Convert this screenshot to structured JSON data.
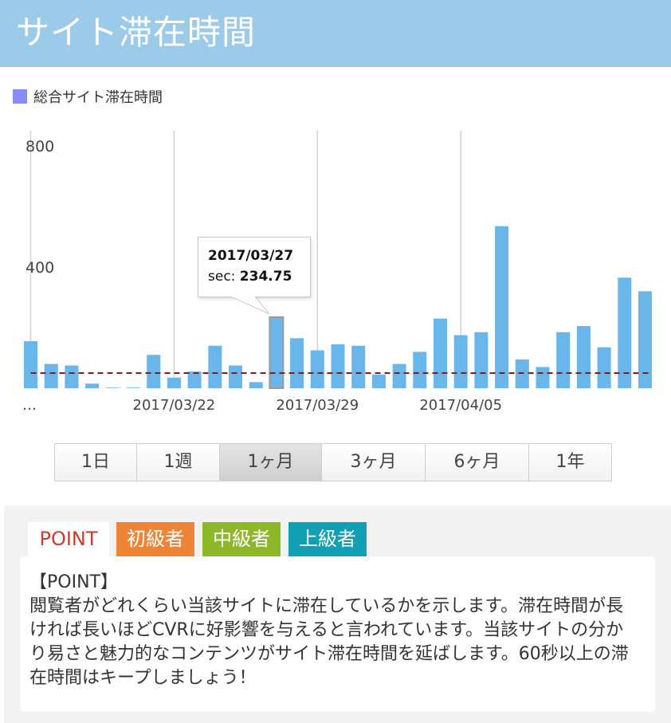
{
  "header": {
    "title": "サイト滞在時間"
  },
  "legend": {
    "label": "総合サイト滞在時間",
    "color": "#8b8bf7"
  },
  "tooltip": {
    "date": "2017/03/27",
    "label": "sec: ",
    "value": "234.75"
  },
  "chart_data": {
    "type": "bar",
    "series": [
      {
        "name": "総合サイト滞在時間",
        "color": "#68b6ea",
        "values": [
          155,
          80,
          75,
          15,
          2,
          2,
          110,
          35,
          55,
          140,
          75,
          20,
          234.75,
          165,
          125,
          145,
          140,
          45,
          80,
          120,
          230,
          175,
          185,
          535,
          95,
          70,
          185,
          205,
          135,
          365,
          320
        ]
      }
    ],
    "highlight_index": 12,
    "average_line": {
      "value": 50,
      "color": "#8b1a1a",
      "style": "dashed"
    },
    "ylim": [
      0,
      800
    ],
    "yticks": [
      {
        "value": 800,
        "label": "800"
      },
      {
        "value": 400,
        "label": "400"
      }
    ],
    "xticks": [
      {
        "index": 0,
        "label": "…"
      },
      {
        "index": 7,
        "label": "2017/03/22"
      },
      {
        "index": 14,
        "label": "2017/03/29"
      },
      {
        "index": 21,
        "label": "2017/04/05"
      }
    ],
    "grid": "vertical"
  },
  "range_selector": {
    "buttons": [
      {
        "label": "1日",
        "active": false
      },
      {
        "label": "1週",
        "active": false
      },
      {
        "label": "1ヶ月",
        "active": true
      },
      {
        "label": "3ヶ月",
        "active": false
      },
      {
        "label": "6ヶ月",
        "active": false
      },
      {
        "label": "1年",
        "active": false
      }
    ]
  },
  "tabs": {
    "point": "POINT",
    "beginner": "初級者",
    "intermediate": "中級者",
    "advanced": "上級者"
  },
  "info": {
    "heading": "【POINT】",
    "body": "閲覧者がどれくらい当該サイトに滞在しているかを示します。滞在時間が長ければ長いほどCVRに好影響を与えると言われています。当該サイトの分かり易さと魅力的なコンテンツがサイト滞在時間を延ばします。60秒以上の滞在時間はキープしましょう！"
  }
}
